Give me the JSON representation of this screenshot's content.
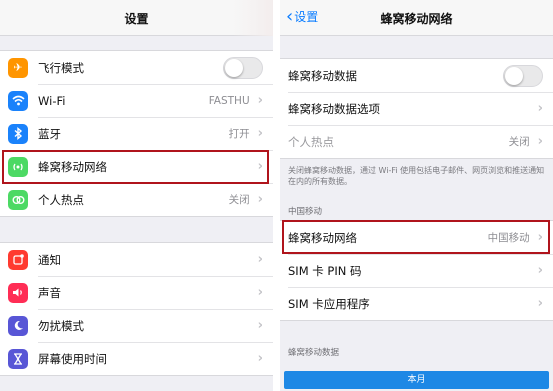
{
  "left": {
    "title": "设置",
    "group1": [
      {
        "icon": "airplane-icon",
        "color": "#ff9500",
        "label": "飞行模式",
        "toggle": false
      },
      {
        "icon": "wifi-icon",
        "color": "#1a82fb",
        "label": "Wi-Fi",
        "value": "FASTHU"
      },
      {
        "icon": "bluetooth-icon",
        "color": "#1a82fb",
        "label": "蓝牙",
        "value": "打开"
      },
      {
        "icon": "cellular-icon",
        "color": "#4cd964",
        "label": "蜂窝移动网络",
        "value": ""
      },
      {
        "icon": "hotspot-icon",
        "color": "#4cd964",
        "label": "个人热点",
        "value": "关闭"
      }
    ],
    "group2": [
      {
        "icon": "notifications-icon",
        "color": "#ff3b30",
        "label": "通知"
      },
      {
        "icon": "sounds-icon",
        "color": "#ff2d55",
        "label": "声音"
      },
      {
        "icon": "do-not-disturb-icon",
        "color": "#5856d6",
        "label": "勿扰模式"
      },
      {
        "icon": "screen-time-icon",
        "color": "#5856d6",
        "label": "屏幕使用时间"
      }
    ]
  },
  "right": {
    "back_label": "设置",
    "title": "蜂窝移动网络",
    "group1": [
      {
        "label": "蜂窝移动数据",
        "toggle": false
      },
      {
        "label": "蜂窝移动数据选项",
        "value": ""
      },
      {
        "label": "个人热点",
        "value": "关闭",
        "dim": true
      }
    ],
    "note": "关闭蜂窝移动数据，通过 Wi-Fi 使用包括电子邮件、网页浏览和推送通知在内的所有数据。",
    "carrier_header": "中国移动",
    "group2": [
      {
        "label": "蜂窝移动网络",
        "value": "中国移动"
      },
      {
        "label": "SIM 卡 PIN 码",
        "value": ""
      },
      {
        "label": "SIM 卡应用程序",
        "value": ""
      }
    ],
    "data_header": "蜂窝移动数据",
    "bottom_button": "本月"
  },
  "colors": {
    "highlight": "#b0141c",
    "accent": "#0a7cff"
  }
}
